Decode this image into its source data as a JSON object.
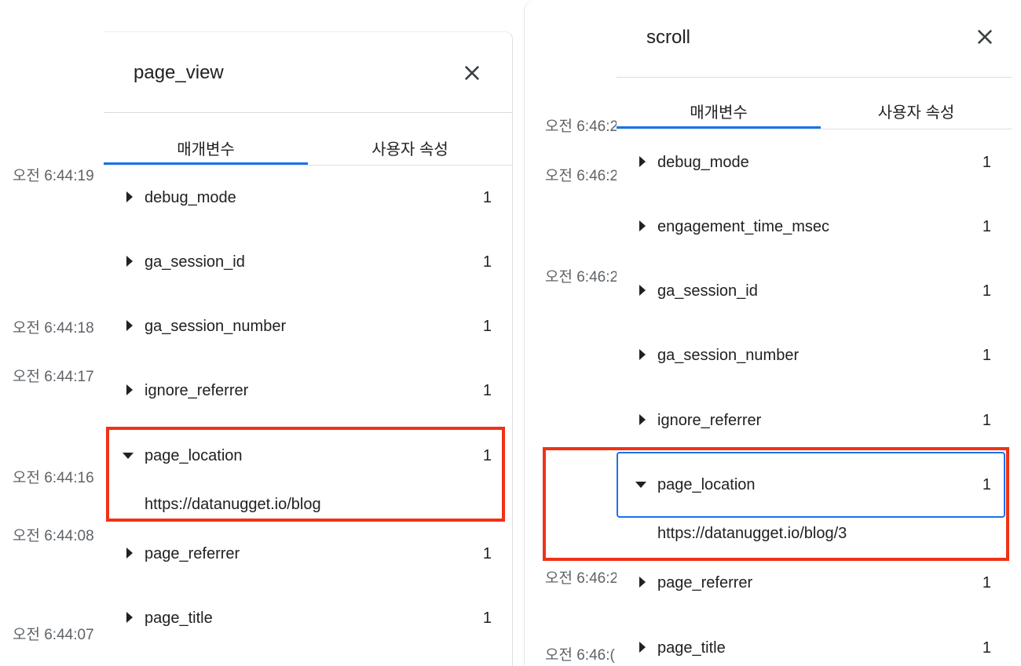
{
  "left_timestamps": [
    "오전 6:44:19",
    "오전 6:44:18",
    "오전 6:44:17",
    "오전 6:44:16",
    "오전 6:44:08",
    "오전 6:44:07"
  ],
  "right_timestamps": [
    "오전 6:46:2",
    "오전 6:46:2",
    "오전 6:46:2",
    "오전 6:46:2",
    "오전 6:46:("
  ],
  "left_panel": {
    "title": "page_view",
    "tabs": [
      {
        "label": "매개변수",
        "active": true
      },
      {
        "label": "사용자 속성",
        "active": false
      }
    ],
    "params": [
      {
        "name": "debug_mode",
        "count": "1",
        "expanded": false
      },
      {
        "name": "ga_session_id",
        "count": "1",
        "expanded": false
      },
      {
        "name": "ga_session_number",
        "count": "1",
        "expanded": false
      },
      {
        "name": "ignore_referrer",
        "count": "1",
        "expanded": false
      },
      {
        "name": "page_location",
        "count": "1",
        "expanded": true,
        "value": "https://datanugget.io/blog"
      },
      {
        "name": "page_referrer",
        "count": "1",
        "expanded": false
      },
      {
        "name": "page_title",
        "count": "1",
        "expanded": false
      }
    ]
  },
  "right_panel": {
    "title": "scroll",
    "tabs": [
      {
        "label": "매개변수",
        "active": true
      },
      {
        "label": "사용자 속성",
        "active": false
      }
    ],
    "params": [
      {
        "name": "debug_mode",
        "count": "1",
        "expanded": false
      },
      {
        "name": "engagement_time_msec",
        "count": "1",
        "expanded": false
      },
      {
        "name": "ga_session_id",
        "count": "1",
        "expanded": false
      },
      {
        "name": "ga_session_number",
        "count": "1",
        "expanded": false
      },
      {
        "name": "ignore_referrer",
        "count": "1",
        "expanded": false
      },
      {
        "name": "page_location",
        "count": "1",
        "expanded": true,
        "value": "https://datanugget.io/blog/3"
      },
      {
        "name": "page_referrer",
        "count": "1",
        "expanded": false
      },
      {
        "name": "page_title",
        "count": "1",
        "expanded": false
      }
    ]
  },
  "colors": {
    "accent": "#1a73e8",
    "highlight": "#f03216",
    "timestamp": "#5f6368"
  },
  "icons": {
    "close": "close-icon",
    "collapsed": "caret-right-icon",
    "expanded": "caret-down-icon"
  }
}
